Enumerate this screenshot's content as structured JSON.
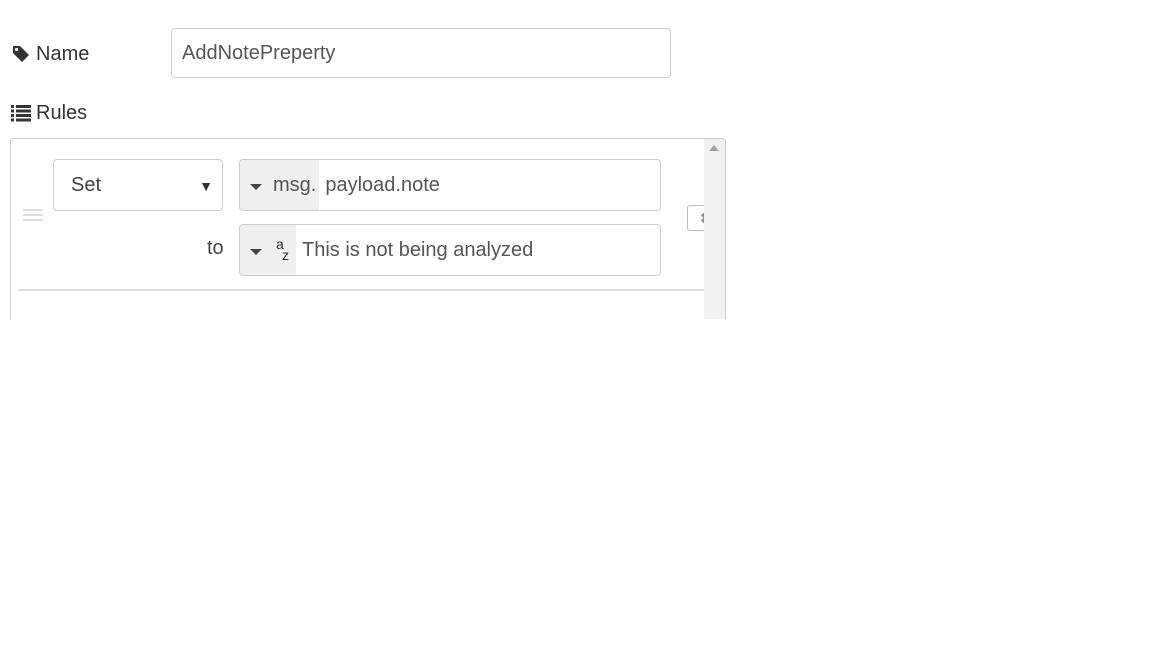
{
  "name_field": {
    "label": "Name",
    "icon": "tag-icon",
    "value": "AddNotePreperty"
  },
  "rules": {
    "label": "Rules",
    "icon": "list-icon",
    "items": [
      {
        "action": "Set",
        "property_type_prefix": "msg.",
        "property_value": "payload.note",
        "to_label": "to",
        "value_type_icon": "string-type-icon",
        "value": "This is not being analyzed"
      }
    ]
  }
}
